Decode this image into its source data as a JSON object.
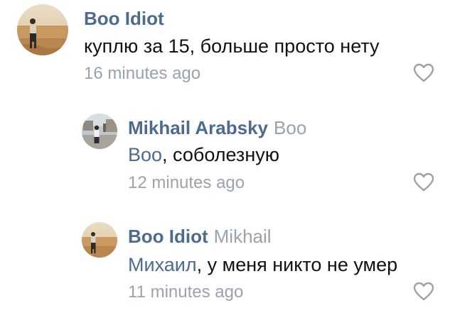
{
  "comments": [
    {
      "author": "Boo Idiot",
      "reply_to": "",
      "mention": "",
      "text": "куплю за 15, больше просто нету",
      "time": "16 minutes ago",
      "avatar_icon": "user-photo-desert"
    },
    {
      "author": "Mikhail Arabsky",
      "reply_to": "Boo",
      "mention": "Boo",
      "text": ", соболезную",
      "time": "12 minutes ago",
      "avatar_icon": "user-photo-street"
    },
    {
      "author": "Boo Idiot",
      "reply_to": "Mikhail",
      "mention": "Михаил",
      "text": ", у меня никто не умер",
      "time": "11 minutes ago",
      "avatar_icon": "user-photo-desert"
    }
  ],
  "icons": {
    "like": "heart-outline-icon"
  },
  "colors": {
    "author": "#4d6b8e",
    "muted": "#9aa2ab",
    "text": "#111111",
    "background": "#ffffff"
  }
}
